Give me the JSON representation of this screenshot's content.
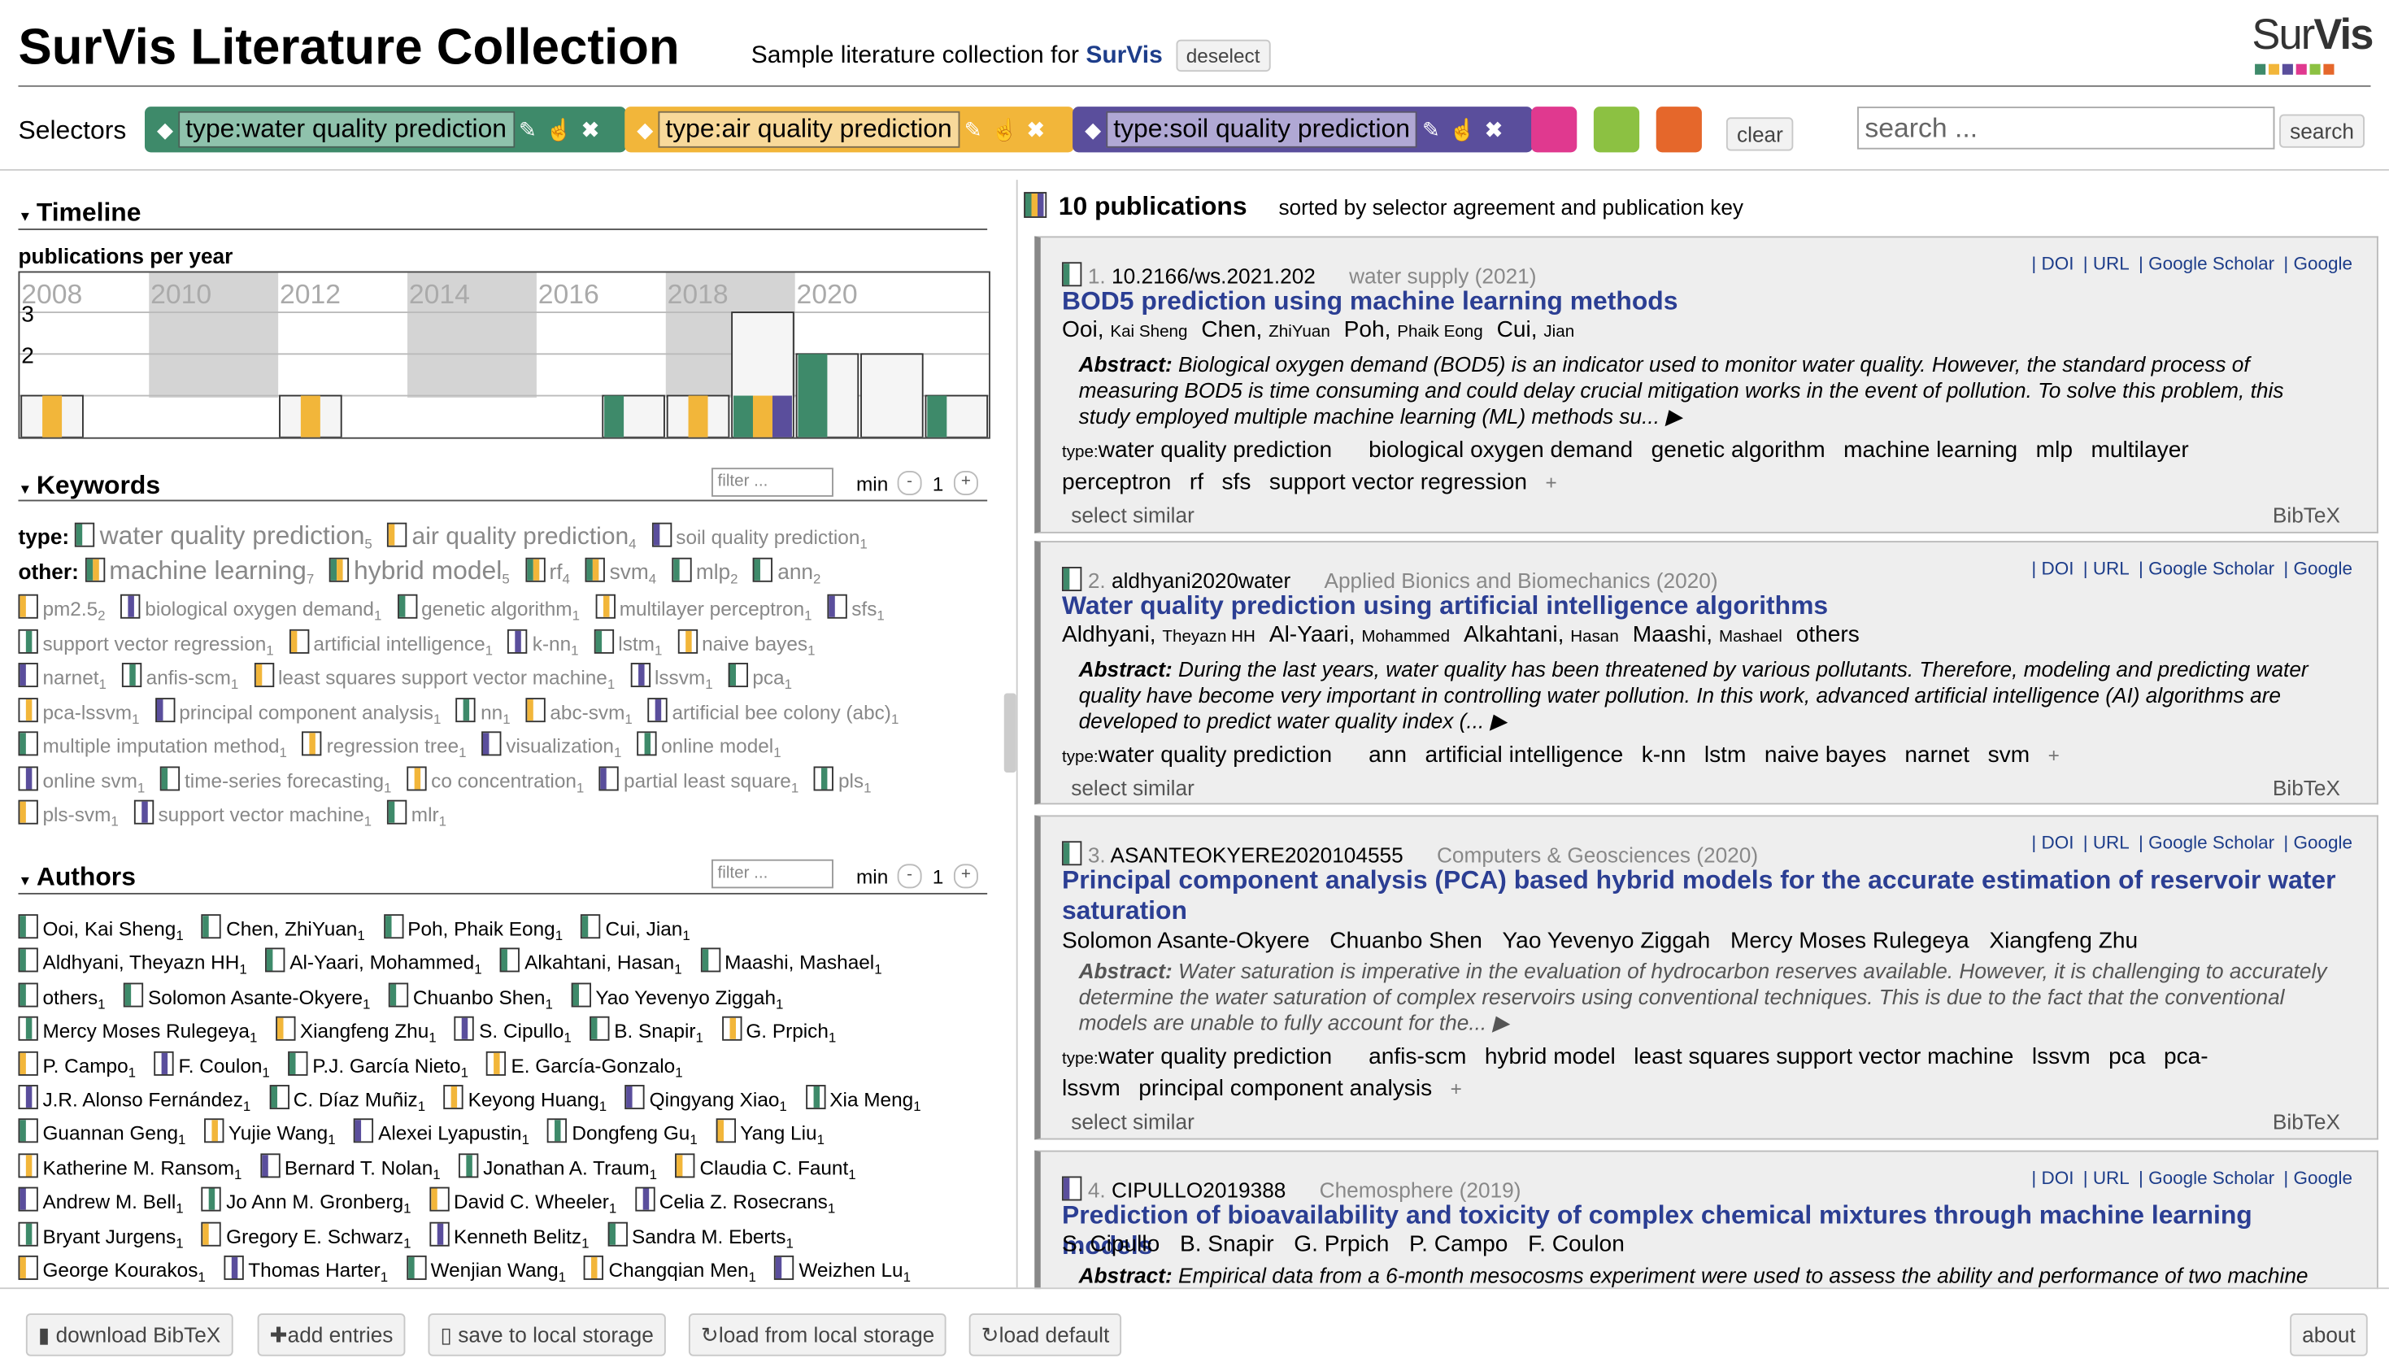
{
  "header": {
    "title": "SurVis Literature Collection",
    "subtitle_prefix": "Sample literature collection for",
    "subtitle_link": "SurVis",
    "deselect": "deselect",
    "logo_text_a": "Sur",
    "logo_text_b": "Vis"
  },
  "colors": {
    "green": "#3e8a6a",
    "yellow": "#f2b63a",
    "purple": "#5a4e9c",
    "pink": "#e0398f",
    "lime": "#8cc142",
    "orange": "#e5672b"
  },
  "selectors": {
    "label": "Selectors",
    "items": [
      {
        "label": "type:water quality prediction",
        "color": "#3e8a6a"
      },
      {
        "label": "type:air quality prediction",
        "color": "#f2b63a"
      },
      {
        "label": "type:soil quality prediction",
        "color": "#5a4e9c"
      }
    ],
    "clear": "clear"
  },
  "search": {
    "placeholder": "search ...",
    "button": "search"
  },
  "timeline": {
    "title": "Timeline",
    "subtitle": "publications per year",
    "axis_labels": [
      "2008",
      "2010",
      "2012",
      "2014",
      "2016",
      "2018",
      "2020"
    ],
    "y_labels": [
      "3",
      "2"
    ]
  },
  "chart_data": {
    "type": "bar",
    "title": "publications per year",
    "x": [
      2008,
      2009,
      2010,
      2011,
      2012,
      2013,
      2014,
      2015,
      2016,
      2017,
      2018,
      2019,
      2020,
      2021,
      2022
    ],
    "series": [
      {
        "name": "type:water quality prediction",
        "values": [
          0,
          0,
          0,
          0,
          0,
          0,
          0,
          0,
          0,
          1,
          0,
          1,
          2,
          0,
          1
        ]
      },
      {
        "name": "type:air quality prediction",
        "values": [
          1,
          0,
          0,
          0,
          1,
          0,
          0,
          0,
          0,
          0,
          1,
          1,
          0,
          0,
          0
        ]
      },
      {
        "name": "type:soil quality prediction",
        "values": [
          0,
          0,
          0,
          0,
          0,
          0,
          0,
          0,
          0,
          0,
          0,
          1,
          0,
          0,
          0
        ]
      }
    ],
    "totals": [
      1,
      0,
      0,
      0,
      1,
      0,
      0,
      0,
      0,
      1,
      1,
      3,
      2,
      2,
      1
    ],
    "ylim": [
      0,
      3
    ]
  },
  "keywords": {
    "title": "Keywords",
    "filter": "filter ...",
    "min_label": "min",
    "min_value": "1",
    "type_label": "type:",
    "other_label": "other:",
    "type_items": [
      {
        "t": "water quality prediction",
        "c": "5"
      },
      {
        "t": "air quality prediction",
        "c": "4"
      },
      {
        "t": "soil quality prediction",
        "c": "1"
      }
    ],
    "other_row1": [
      {
        "t": "machine learning",
        "c": "7"
      },
      {
        "t": "hybrid model",
        "c": "5"
      },
      {
        "t": "rf",
        "c": "4"
      },
      {
        "t": "svm",
        "c": "4"
      },
      {
        "t": "mlp",
        "c": "2"
      },
      {
        "t": "ann",
        "c": "2"
      }
    ],
    "rows": [
      [
        {
          "t": "pm2.5",
          "c": "2"
        },
        {
          "t": "biological oxygen demand",
          "c": "1"
        },
        {
          "t": "genetic algorithm",
          "c": "1"
        },
        {
          "t": "multilayer perceptron",
          "c": "1"
        },
        {
          "t": "sfs",
          "c": "1"
        }
      ],
      [
        {
          "t": "support vector regression",
          "c": "1"
        },
        {
          "t": "artificial intelligence",
          "c": "1"
        },
        {
          "t": "k-nn",
          "c": "1"
        },
        {
          "t": "lstm",
          "c": "1"
        },
        {
          "t": "naive bayes",
          "c": "1"
        }
      ],
      [
        {
          "t": "narnet",
          "c": "1"
        },
        {
          "t": "anfis-scm",
          "c": "1"
        },
        {
          "t": "least squares support vector machine",
          "c": "1"
        },
        {
          "t": "lssvm",
          "c": "1"
        },
        {
          "t": "pca",
          "c": "1"
        }
      ],
      [
        {
          "t": "pca-lssvm",
          "c": "1"
        },
        {
          "t": "principal component analysis",
          "c": "1"
        },
        {
          "t": "nn",
          "c": "1"
        },
        {
          "t": "abc-svm",
          "c": "1"
        },
        {
          "t": "artificial bee colony (abc)",
          "c": "1"
        }
      ],
      [
        {
          "t": "multiple imputation method",
          "c": "1"
        },
        {
          "t": "regression tree",
          "c": "1"
        },
        {
          "t": "visualization",
          "c": "1"
        },
        {
          "t": "online model",
          "c": "1"
        }
      ],
      [
        {
          "t": "online svm",
          "c": "1"
        },
        {
          "t": "time-series forecasting",
          "c": "1"
        },
        {
          "t": "co concentration",
          "c": "1"
        },
        {
          "t": "partial least square",
          "c": "1"
        },
        {
          "t": "pls",
          "c": "1"
        }
      ],
      [
        {
          "t": "pls-svm",
          "c": "1"
        },
        {
          "t": "support vector machine",
          "c": "1"
        },
        {
          "t": "mlr",
          "c": "1"
        }
      ]
    ]
  },
  "authors": {
    "title": "Authors",
    "filter": "filter ...",
    "min_label": "min",
    "min_value": "1",
    "rows": [
      [
        {
          "t": "Ooi, Kai Sheng",
          "c": "1"
        },
        {
          "t": "Chen, ZhiYuan",
          "c": "1"
        },
        {
          "t": "Poh, Phaik Eong",
          "c": "1"
        },
        {
          "t": "Cui, Jian",
          "c": "1"
        }
      ],
      [
        {
          "t": "Aldhyani, Theyazn HH",
          "c": "1"
        },
        {
          "t": "Al-Yaari, Mohammed",
          "c": "1"
        },
        {
          "t": "Alkahtani, Hasan",
          "c": "1"
        },
        {
          "t": "Maashi, Mashael",
          "c": "1"
        }
      ],
      [
        {
          "t": "others",
          "c": "1"
        },
        {
          "t": "Solomon Asante-Okyere",
          "c": "1"
        },
        {
          "t": "Chuanbo Shen",
          "c": "1"
        },
        {
          "t": "Yao Yevenyo Ziggah",
          "c": "1"
        }
      ],
      [
        {
          "t": "Mercy Moses Rulegeya",
          "c": "1"
        },
        {
          "t": "Xiangfeng Zhu",
          "c": "1"
        },
        {
          "t": "S. Cipullo",
          "c": "1"
        },
        {
          "t": "B. Snapir",
          "c": "1"
        },
        {
          "t": "G. Prpich",
          "c": "1"
        }
      ],
      [
        {
          "t": "P. Campo",
          "c": "1"
        },
        {
          "t": "F. Coulon",
          "c": "1"
        },
        {
          "t": "P.J. García Nieto",
          "c": "1"
        },
        {
          "t": "E. García-Gonzalo",
          "c": "1"
        }
      ],
      [
        {
          "t": "J.R. Alonso Fernández",
          "c": "1"
        },
        {
          "t": "C. Díaz Muñiz",
          "c": "1"
        },
        {
          "t": "Keyong Huang",
          "c": "1"
        },
        {
          "t": "Qingyang Xiao",
          "c": "1"
        },
        {
          "t": "Xia Meng",
          "c": "1"
        }
      ],
      [
        {
          "t": "Guannan Geng",
          "c": "1"
        },
        {
          "t": "Yujie Wang",
          "c": "1"
        },
        {
          "t": "Alexei Lyapustin",
          "c": "1"
        },
        {
          "t": "Dongfeng Gu",
          "c": "1"
        },
        {
          "t": "Yang Liu",
          "c": "1"
        }
      ],
      [
        {
          "t": "Katherine M. Ransom",
          "c": "1"
        },
        {
          "t": "Bernard T. Nolan",
          "c": "1"
        },
        {
          "t": "Jonathan A. Traum",
          "c": "1"
        },
        {
          "t": "Claudia C. Faunt",
          "c": "1"
        }
      ],
      [
        {
          "t": "Andrew M. Bell",
          "c": "1"
        },
        {
          "t": "Jo Ann M. Gronberg",
          "c": "1"
        },
        {
          "t": "David C. Wheeler",
          "c": "1"
        },
        {
          "t": "Celia Z. Rosecrans",
          "c": "1"
        }
      ],
      [
        {
          "t": "Bryant Jurgens",
          "c": "1"
        },
        {
          "t": "Gregory E. Schwarz",
          "c": "1"
        },
        {
          "t": "Kenneth Belitz",
          "c": "1"
        },
        {
          "t": "Sandra M. Eberts",
          "c": "1"
        }
      ],
      [
        {
          "t": "George Kourakos",
          "c": "1"
        },
        {
          "t": "Thomas Harter",
          "c": "1"
        },
        {
          "t": "Wenjian Wang",
          "c": "1"
        },
        {
          "t": "Changqian Men",
          "c": "1"
        },
        {
          "t": "Weizhen Lu",
          "c": "1"
        }
      ]
    ]
  },
  "publications": {
    "count_label": "10 publications",
    "sort_label": "sorted by selector agreement and publication key",
    "links": [
      "DOI",
      "URL",
      "Google Scholar",
      "Google"
    ],
    "select_similar": "select similar",
    "bibtex": "BibTeX",
    "plus": "+",
    "abstract_label": "Abstract:",
    "items": [
      {
        "num": "1.",
        "key": "10.2166/ws.2021.202",
        "venue": "water supply",
        "year": "(2021)",
        "title": "BOD5 prediction using machine learning methods",
        "authors": [
          [
            "Ooi,",
            "Kai Sheng"
          ],
          [
            "Chen,",
            "ZhiYuan"
          ],
          [
            "Poh,",
            "Phaik Eong"
          ],
          [
            "Cui,",
            "Jian"
          ]
        ],
        "abstract": "Biological oxygen demand (BOD5) is an indicator used to monitor water quality. However, the standard process of measuring BOD5 is time consuming and could delay crucial mitigation works in the event of pollution. To solve this problem, this study employed multiple machine learning (ML) methods su... ▶",
        "type_kw": "water quality prediction",
        "kws": [
          "biological oxygen demand",
          "genetic algorithm",
          "machine learning",
          "mlp",
          "multilayer perceptron",
          "rf",
          "sfs",
          "support vector regression"
        ]
      },
      {
        "num": "2.",
        "key": "aldhyani2020water",
        "venue": "Applied Bionics and Biomechanics",
        "year": "(2020)",
        "title": "Water quality prediction using artificial intelligence algorithms",
        "authors": [
          [
            "Aldhyani,",
            "Theyazn HH"
          ],
          [
            "Al-Yaari,",
            "Mohammed"
          ],
          [
            "Alkahtani,",
            "Hasan"
          ],
          [
            "Maashi,",
            "Mashael"
          ],
          [
            "others",
            ""
          ]
        ],
        "abstract": "During the last years, water quality has been threatened by various pollutants. Therefore, modeling and predicting water quality have become very important in controlling water pollution. In this work, advanced artificial intelligence (AI) algorithms are developed to predict water quality index (... ▶",
        "type_kw": "water quality prediction",
        "kws": [
          "ann",
          "artificial intelligence",
          "k-nn",
          "lstm",
          "naive bayes",
          "narnet",
          "svm"
        ]
      },
      {
        "num": "3.",
        "key": "ASANTEOKYERE2020104555",
        "venue": "Computers & Geosciences",
        "year": "(2020)",
        "title": "Principal component analysis (PCA) based hybrid models for the accurate estimation of reservoir water saturation",
        "authors": [
          [
            "Solomon Asante-Okyere",
            ""
          ],
          [
            "Chuanbo Shen",
            ""
          ],
          [
            "Yao Yevenyo Ziggah",
            ""
          ],
          [
            "Mercy Moses Rulegeya",
            ""
          ],
          [
            "Xiangfeng Zhu",
            ""
          ]
        ],
        "abstract": "Water saturation is imperative in the evaluation of hydrocarbon reserves available. However, it is challenging to accurately determine the water saturation of complex reservoirs using conventional techniques. This is due to the fact that the conventional models are unable to fully account for the... ▶",
        "type_kw": "water quality prediction",
        "kws": [
          "anfis-scm",
          "hybrid model",
          "least squares support vector machine",
          "lssvm",
          "pca",
          "pca-lssvm",
          "principal component analysis"
        ]
      },
      {
        "num": "4.",
        "key": "CIPULLO2019388",
        "venue": "Chemosphere",
        "year": "(2019)",
        "title": "Prediction of bioavailability and toxicity of complex chemical mixtures through machine learning models",
        "authors": [
          [
            "S. Cipullo",
            ""
          ],
          [
            "B. Snapir",
            ""
          ],
          [
            "G. Prpich",
            ""
          ],
          [
            "P. Campo",
            ""
          ],
          [
            "F. Coulon",
            ""
          ]
        ],
        "abstract": "Empirical data from a 6-month mesocosms experiment were used to assess the ability and performance of two machine"
      }
    ]
  },
  "footer": {
    "buttons": [
      "download BibTeX",
      "add entries",
      "save to local storage",
      "load from local storage",
      "load default"
    ],
    "about": "about"
  }
}
